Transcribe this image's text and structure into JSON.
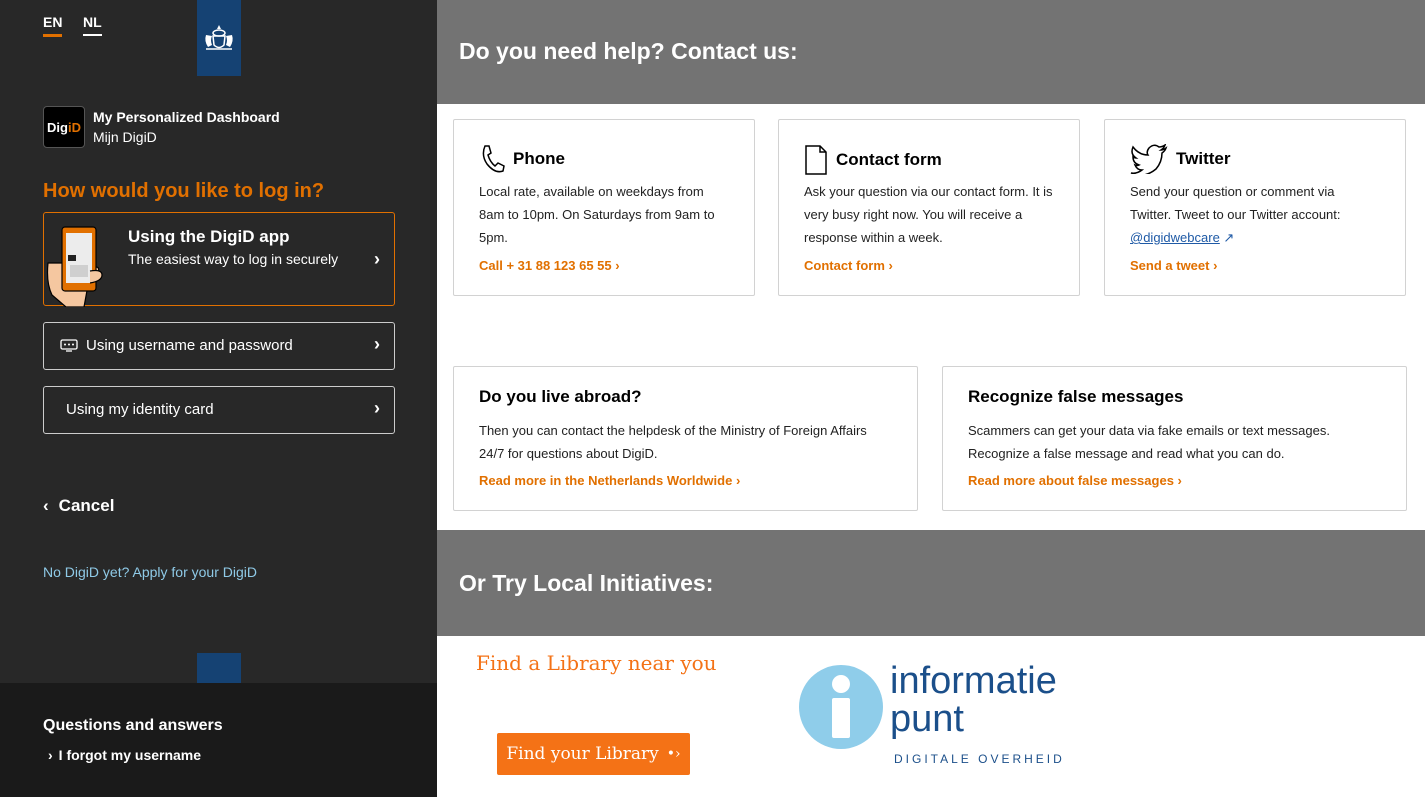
{
  "language": {
    "en": "EN",
    "nl": "NL"
  },
  "brand": {
    "logo_a": "Dig",
    "logo_b": "iD",
    "title": "My Personalized Dashboard",
    "subtitle": "Mijn DigiD"
  },
  "login": {
    "question": "How would you like to log in?",
    "app_title": "Using the DigiD app",
    "app_sub": "The easiest way to log in securely",
    "username_password": "Using username and password",
    "identity_card": "Using my identity card",
    "cancel": "Cancel",
    "apply": "No DigiD yet? Apply for your DigiD"
  },
  "footer": {
    "qa": "Questions and answers",
    "forgot": "I forgot my username"
  },
  "help": {
    "heading": "Do you need help? Contact us:",
    "phone": {
      "title": "Phone",
      "body": "Local rate, available on weekdays from 8am to 10pm. On Saturdays from 9am to 5pm.",
      "link": "Call + 31 88 123 65 55"
    },
    "contact": {
      "title": "Contact form",
      "body": "Ask your question via our contact form. It is very busy right now. You will receive a response within a week.",
      "link": "Contact form"
    },
    "twitter": {
      "title": "Twitter",
      "body": "Send your question or comment via Twitter. Tweet to our Twitter account:",
      "handle": "@digidwebcare",
      "link": "Send a tweet"
    },
    "abroad": {
      "title": "Do you live abroad?",
      "body": "Then you can contact the helpdesk of the Ministry of Foreign Affairs 24/7 for questions about DigiD.",
      "link": "Read more in the Netherlands Worldwide"
    },
    "false_msg": {
      "title": "Recognize false messages",
      "body": "Scammers can get your data via fake emails or text messages. Recognize a false message and read what you can do.",
      "link": "Read more about false messages"
    }
  },
  "local": {
    "heading": "Or Try Local Initiatives:",
    "library_title": "Find a Library near you",
    "library_button": "Find your Library",
    "logo_line1": "informatie",
    "logo_line2": "punt",
    "logo_sub": "DIGITALE OVERHEID"
  },
  "colors": {
    "accent": "#e17000",
    "panel": "#282828",
    "band": "#737373",
    "rijksblauw": "#154273"
  }
}
